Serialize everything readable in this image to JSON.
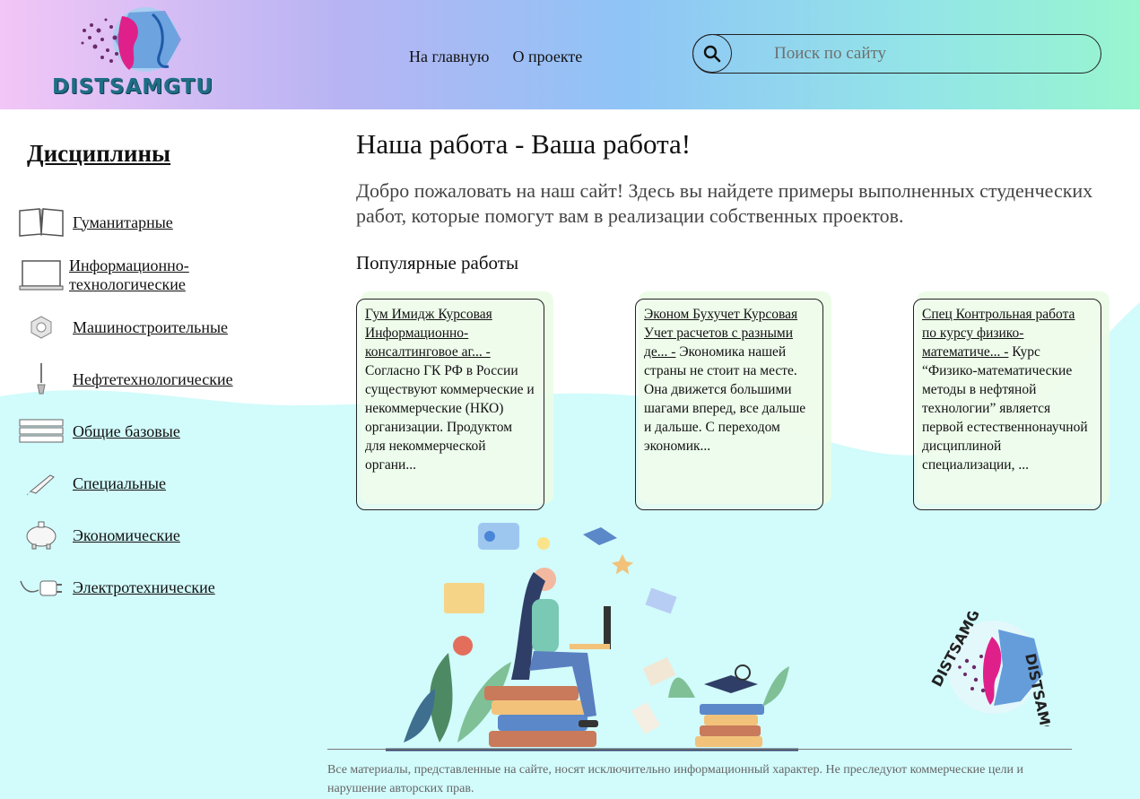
{
  "header": {
    "logo_text": "DISTSAMGTU",
    "nav": [
      {
        "label": "На главную"
      },
      {
        "label": "О проекте"
      }
    ],
    "search": {
      "placeholder": "Поиск по сайту"
    }
  },
  "sidebar": {
    "title": "Дисциплины",
    "items": [
      {
        "label": "Гуманитарные",
        "icon": "book-icon"
      },
      {
        "label": "Информационно-технологические",
        "icon": "laptop-icon"
      },
      {
        "label": "Машиностроительные",
        "icon": "nut-icon"
      },
      {
        "label": "Нефтетехнологические",
        "icon": "oil-drop-icon"
      },
      {
        "label": "Общие базовые",
        "icon": "books-stack-icon"
      },
      {
        "label": "Специальные",
        "icon": "rocket-icon"
      },
      {
        "label": "Экономические",
        "icon": "piggy-bank-icon"
      },
      {
        "label": "Электротехнические",
        "icon": "plug-icon"
      }
    ]
  },
  "main": {
    "title": "Наша работа - Ваша работа!",
    "intro": "Добро пожаловать на наш сайт! Здесь вы найдете примеры выполненных студенческих работ, которые помогут вам в реализации собственных проектов.",
    "popular_title": "Популярные работы",
    "cards": [
      {
        "title": "Гум Имидж Курсовая Информационно-консалтинговое аг... -",
        "desc": "Согласно ГК РФ в России существуют коммерческие и некоммерческие (НКО) организации. Продуктом для некоммерческой органи..."
      },
      {
        "title": "Эконом Бухучет Курсовая Учет расчетов с разными де... -",
        "desc": "Экономика нашей страны не стоит на месте. Она движется большими шагами вперед, все дальше и дальше. С переходом экономик..."
      },
      {
        "title": "Спец Контрольная работа по курсу физико-математиче... -",
        "desc": "Курс “Физико-математические методы в нефтяной технологии” является первой естественнонаучной дисциплиной специализации, ..."
      }
    ]
  },
  "stamp_text": "DISTSAMGTU",
  "footer": {
    "text": "Все материалы, представленные на сайте, носят исключительно информационный характер. Не преследуют коммерческие цели и нарушение авторских прав."
  },
  "colors": {
    "header_gradient": [
      "#f2c6f6",
      "#b7b4f3",
      "#8fc4f6",
      "#93e4e8",
      "#98f6cf"
    ],
    "wave": "#d0fbfb",
    "logo_text": "#1f6e86"
  }
}
